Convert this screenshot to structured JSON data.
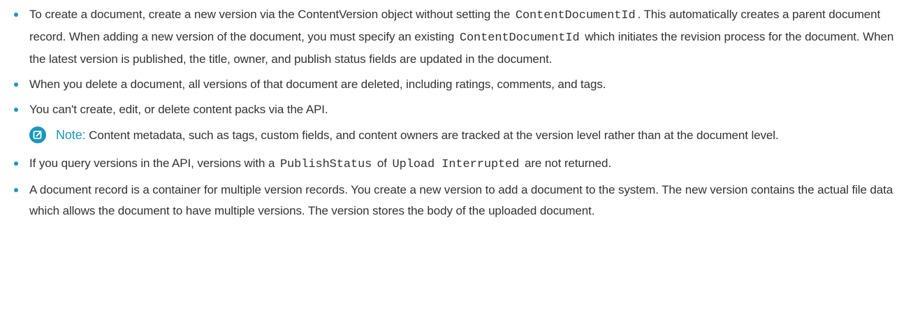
{
  "items": [
    {
      "a": "To create a document, create a new version via the ContentVersion object without setting the ",
      "code1": "ContentDocumentId",
      "b": ". This automatically creates a parent document record. When adding a new version of the document, you must specify an existing ",
      "code2": "ContentDocumentId",
      "c": " which initiates the revision process for the document. When the latest version is published, the title, owner, and publish status fields are updated in the document."
    },
    {
      "text": "When you delete a document, all versions of that document are deleted, including ratings, comments, and tags."
    },
    {
      "text": "You can't create, edit, or delete content packs via the API."
    },
    {
      "a": "If you query versions in the API, versions with a ",
      "code1": "PublishStatus",
      "b": " of ",
      "code2": "Upload Interrupted",
      "c": " are not returned."
    },
    {
      "text": "A document record is a container for multiple version records. You create a new version to add a document to the system. The new version contains the actual file data which allows the document to have multiple versions. The version stores the body of the uploaded document."
    }
  ],
  "note": {
    "icon": "note-edit-icon",
    "label": "Note:",
    "text": "Content metadata, such as tags, custom fields, and content owners are tracked at the version level rather than at the document level."
  },
  "colors": {
    "accent": "#1798c1",
    "text": "#333333"
  }
}
